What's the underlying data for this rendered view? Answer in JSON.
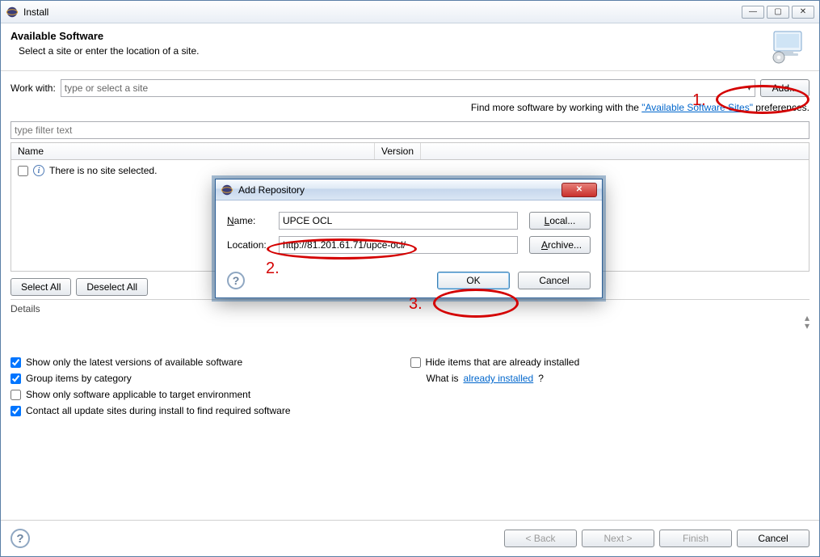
{
  "window": {
    "title": "Install"
  },
  "header": {
    "heading": "Available Software",
    "subheading": "Select a site or enter the location of a site."
  },
  "workWith": {
    "label": "Work with:",
    "placeholder": "type or select a site",
    "addButton": "Add..."
  },
  "hint": {
    "prefix": "Find more software by working with the ",
    "link": "\"Available Software Sites\"",
    "suffix": " preferences."
  },
  "filter": {
    "placeholder": "type filter text"
  },
  "columns": {
    "name": "Name",
    "version": "Version"
  },
  "list": {
    "empty": "There is no site selected."
  },
  "selectAll": "Select All",
  "deselectAll": "Deselect All",
  "details": {
    "label": "Details"
  },
  "options": {
    "showLatest": "Show only the latest versions of available software",
    "hideInstalled": "Hide items that are already installed",
    "groupCategory": "Group items by category",
    "whatIsPrefix": "What is ",
    "whatIsLink": "already installed",
    "whatIsSuffix": "?",
    "targetEnv": "Show only software applicable to target environment",
    "contactSites": "Contact all update sites during install to find required software"
  },
  "footer": {
    "back": "< Back",
    "next": "Next >",
    "finish": "Finish",
    "cancel": "Cancel"
  },
  "modal": {
    "title": "Add Repository",
    "nameLabel": "Name:",
    "nameValue": "UPCE OCL",
    "localBtn": "Local...",
    "locationLabel": "Location:",
    "locationValue": "http://81.201.61.71/upce-ocl/",
    "archiveBtn": "Archive...",
    "ok": "OK",
    "cancel": "Cancel"
  },
  "annotations": {
    "one": "1.",
    "two": "2.",
    "three": "3."
  }
}
